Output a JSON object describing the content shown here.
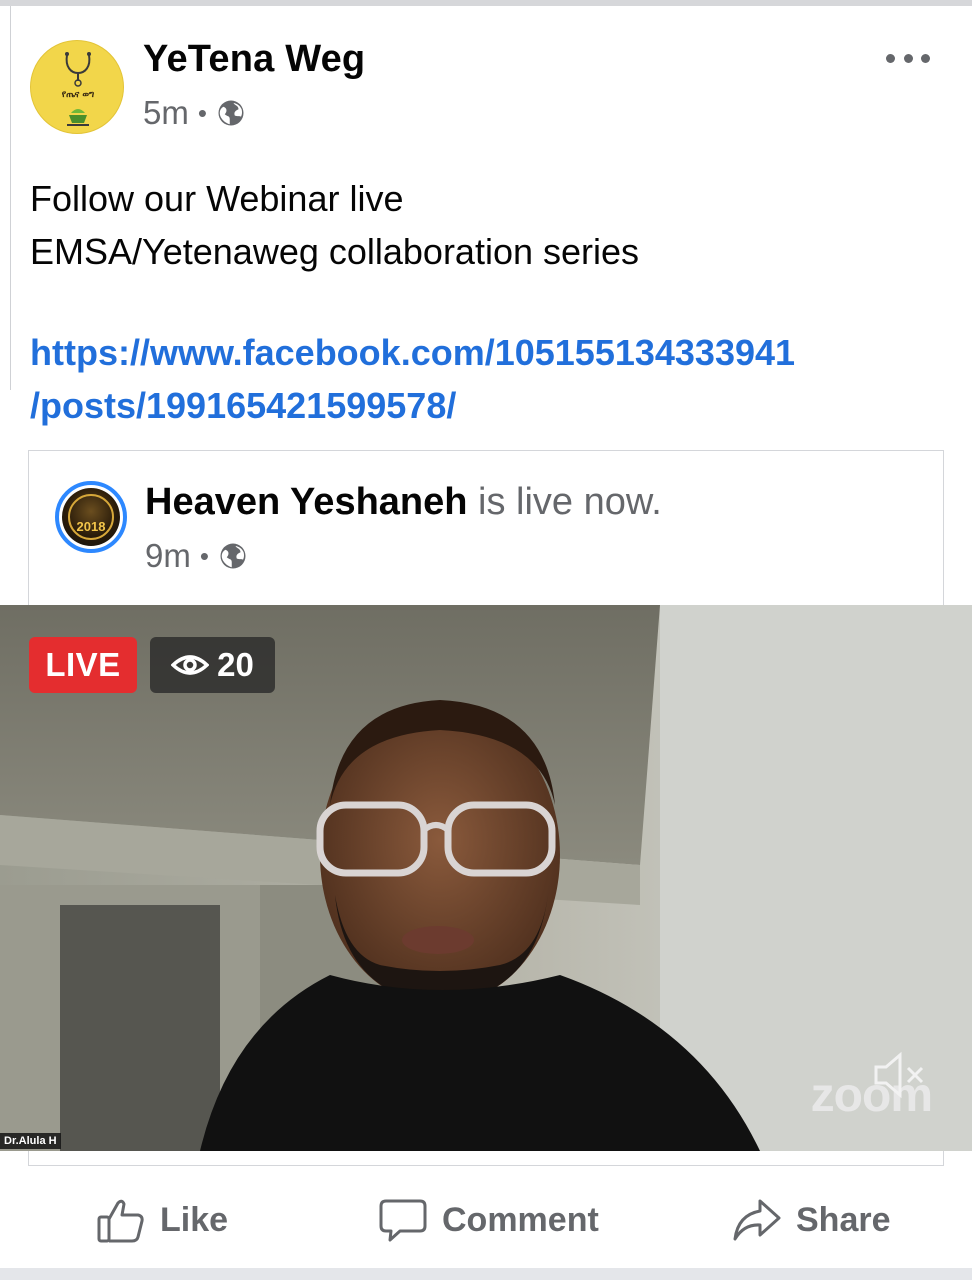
{
  "post": {
    "page_name": "YeTena Weg",
    "time": "5m",
    "avatar_text": "የጤና ወግ",
    "text_lines": [
      "Follow our Webinar live",
      "EMSA/Yetenaweg collaboration series"
    ],
    "link_lines": [
      "https://www.facebook.com/105155134333941",
      "/posts/199165421599578/"
    ]
  },
  "shared": {
    "name": "Heaven Yeshaneh",
    "status": "is live now.",
    "time": "9m",
    "avatar_year": "2018"
  },
  "video": {
    "live_label": "LIVE",
    "viewers": "20",
    "speaker_tag": "Dr.Alula H",
    "watermark": "zoom"
  },
  "actions": {
    "like": "Like",
    "comment": "Comment",
    "share": "Share"
  },
  "colors": {
    "link": "#216fdb",
    "live_red": "#e42d2f",
    "meta_gray": "#65676b",
    "avatar_yellow": "#f2d64a"
  }
}
